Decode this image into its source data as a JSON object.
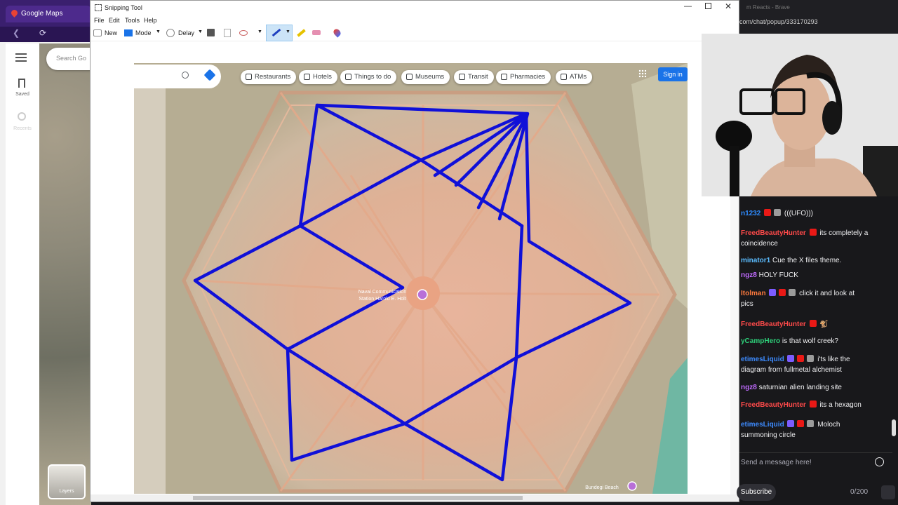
{
  "gmaps": {
    "tab_title": "Google Maps",
    "search_placeholder": "Search Go",
    "saved_label": "Saved",
    "recents_label": "Recents",
    "layers_label": "Layers"
  },
  "snip": {
    "title": "Snipping Tool",
    "menu": [
      "File",
      "Edit",
      "Tools",
      "Help"
    ],
    "toolbar": {
      "new": "New",
      "mode": "Mode",
      "delay": "Delay"
    }
  },
  "map": {
    "chips": [
      "Restaurants",
      "Hotels",
      "Things to do",
      "Museums",
      "Transit",
      "Pharmacies",
      "ATMs"
    ],
    "sign_in": "Sign in",
    "place_label_line1": "Naval Communication",
    "place_label_line2": "Station Harold E. Holt",
    "beach_label": "Bundegi Beach"
  },
  "chat": {
    "tab_title": "m Reacts - Brave",
    "url": "com/chat/popup/333170293",
    "messages": [
      {
        "user": "n1232",
        "color": "#2e8bff",
        "text": "(((UFO)))"
      },
      {
        "user": "FreedBeautyHunter",
        "color": "#ff4a4a",
        "text": "its completely a"
      },
      {
        "user": "",
        "color": "#efeff1",
        "text": "coincidence"
      },
      {
        "user": "minator1",
        "color": "#5bbcff",
        "text": "Cue the X files theme."
      },
      {
        "user": "ngz8",
        "color": "#c06bff",
        "text": "HOLY FUCK"
      },
      {
        "user": "Itolman",
        "color": "#ff7a3d",
        "text": "click it and look at"
      },
      {
        "user": "",
        "color": "#efeff1",
        "text": "pics"
      },
      {
        "user": "FreedBeautyHunter",
        "color": "#ff4a4a",
        "text": ""
      },
      {
        "user": "yCampHero",
        "color": "#2ed07a",
        "text": "is that wolf creek?"
      },
      {
        "user": "etimesLiquid",
        "color": "#3d8bff",
        "text": "i'ts like the"
      },
      {
        "user": "",
        "color": "#efeff1",
        "text": "diagram from fullmetal alchemist"
      },
      {
        "user": "ngz8",
        "color": "#c06bff",
        "text": "saturnian alien landing site"
      },
      {
        "user": "FreedBeautyHunter",
        "color": "#ff4a4a",
        "text": "its a hexagon"
      },
      {
        "user": "etimesLiquid",
        "color": "#3d8bff",
        "text": "Moloch"
      },
      {
        "user": "",
        "color": "#efeff1",
        "text": "summoning circle"
      }
    ],
    "input_placeholder": "Send a message here!",
    "subscribe_label": "Subscribe",
    "char_count": "0/200"
  }
}
